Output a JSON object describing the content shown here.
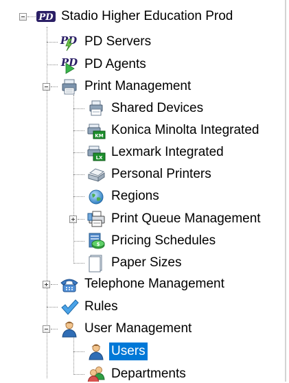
{
  "tree": {
    "root": {
      "label": "Stadio Higher Education Prod",
      "icon": "pd-logo-icon",
      "expanded": true
    },
    "pd_servers": {
      "label": "PD Servers",
      "icon": "pd-servers-icon"
    },
    "pd_agents": {
      "label": "PD Agents",
      "icon": "pd-agents-icon"
    },
    "print_management": {
      "label": "Print Management",
      "icon": "print-management-icon",
      "expanded": true,
      "children": {
        "shared_devices": {
          "label": "Shared Devices",
          "icon": "shared-devices-icon"
        },
        "konica": {
          "label": "Konica Minolta Integrated",
          "icon": "konica-printer-icon",
          "badge": "KM"
        },
        "lexmark": {
          "label": "Lexmark Integrated",
          "icon": "lexmark-printer-icon",
          "badge": "LX"
        },
        "personal_printers": {
          "label": "Personal Printers",
          "icon": "personal-printer-icon"
        },
        "regions": {
          "label": "Regions",
          "icon": "globe-icon"
        },
        "print_queue": {
          "label": "Print Queue Management",
          "icon": "print-queue-icon",
          "expanded": false
        },
        "pricing": {
          "label": "Pricing Schedules",
          "icon": "pricing-schedule-icon"
        },
        "paper_sizes": {
          "label": "Paper Sizes",
          "icon": "paper-icon"
        }
      }
    },
    "telephone_management": {
      "label": "Telephone Management",
      "icon": "telephone-icon",
      "expanded": false
    },
    "rules": {
      "label": "Rules",
      "icon": "checkmark-icon"
    },
    "user_management": {
      "label": "User Management",
      "icon": "user-icon",
      "expanded": true,
      "children": {
        "users": {
          "label": "Users",
          "icon": "user-icon",
          "selected": true
        },
        "departments": {
          "label": "Departments",
          "icon": "group-icon"
        }
      }
    }
  },
  "colors": {
    "selection": "#0078d7",
    "pd_purple": "#2b1f66",
    "connector": "#8a8a8a"
  }
}
